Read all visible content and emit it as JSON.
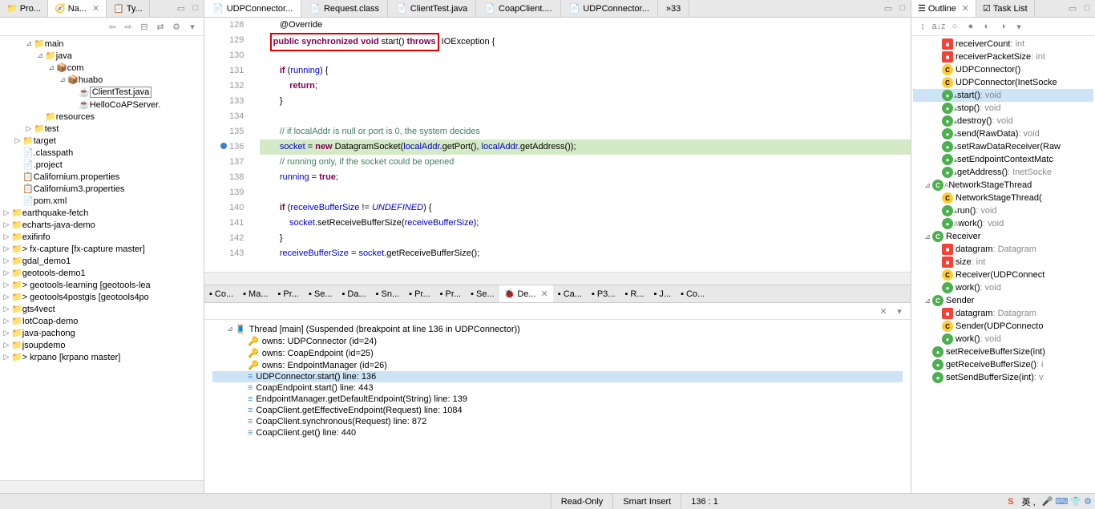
{
  "leftTabs": [
    "Pro...",
    "Na...",
    "Ty..."
  ],
  "projectTree": [
    {
      "indent": 2,
      "tw": "⊿",
      "icon": "folder",
      "label": "main"
    },
    {
      "indent": 3,
      "tw": "⊿",
      "icon": "folder",
      "label": "java"
    },
    {
      "indent": 4,
      "tw": "⊿",
      "icon": "pkg",
      "label": "com"
    },
    {
      "indent": 5,
      "tw": "⊿",
      "icon": "pkg",
      "label": "huabo"
    },
    {
      "indent": 6,
      "tw": "",
      "icon": "java",
      "label": "ClientTest.java",
      "boxed": true
    },
    {
      "indent": 6,
      "tw": "",
      "icon": "java",
      "label": "HelloCoAPServer."
    },
    {
      "indent": 3,
      "tw": "",
      "icon": "folder",
      "label": "resources"
    },
    {
      "indent": 2,
      "tw": "▷",
      "icon": "folder",
      "label": "test"
    },
    {
      "indent": 1,
      "tw": "▷",
      "icon": "folder",
      "label": "target"
    },
    {
      "indent": 1,
      "tw": "",
      "icon": "xml",
      "label": ".classpath"
    },
    {
      "indent": 1,
      "tw": "",
      "icon": "xml",
      "label": ".project"
    },
    {
      "indent": 1,
      "tw": "",
      "icon": "prop",
      "label": "Californium.properties"
    },
    {
      "indent": 1,
      "tw": "",
      "icon": "prop",
      "label": "Californium3.properties"
    },
    {
      "indent": 1,
      "tw": "",
      "icon": "xml",
      "label": "pom.xml"
    },
    {
      "indent": 0,
      "tw": "▷",
      "icon": "proj",
      "label": "earthquake-fetch"
    },
    {
      "indent": 0,
      "tw": "▷",
      "icon": "proj",
      "label": "echarts-java-demo"
    },
    {
      "indent": 0,
      "tw": "▷",
      "icon": "proj",
      "label": "exifinfo"
    },
    {
      "indent": 0,
      "tw": "▷",
      "icon": "proj",
      "label": "> fx-capture [fx-capture master]"
    },
    {
      "indent": 0,
      "tw": "▷",
      "icon": "proj",
      "label": "gdal_demo1"
    },
    {
      "indent": 0,
      "tw": "▷",
      "icon": "proj",
      "label": "geotools-demo1"
    },
    {
      "indent": 0,
      "tw": "▷",
      "icon": "proj",
      "label": "> geotools-learning [geotools-lea"
    },
    {
      "indent": 0,
      "tw": "▷",
      "icon": "proj",
      "label": "> geotools4postgis [geotools4po"
    },
    {
      "indent": 0,
      "tw": "▷",
      "icon": "proj",
      "label": "gts4vect"
    },
    {
      "indent": 0,
      "tw": "▷",
      "icon": "proj",
      "label": "IotCoap-demo"
    },
    {
      "indent": 0,
      "tw": "▷",
      "icon": "proj",
      "label": "java-pachong"
    },
    {
      "indent": 0,
      "tw": "▷",
      "icon": "proj",
      "label": "jsoupdemo"
    },
    {
      "indent": 0,
      "tw": "▷",
      "icon": "proj",
      "label": "> krpano [krpano master]"
    }
  ],
  "editorTabs": [
    {
      "label": "UDPConnector...",
      "icon": "class",
      "active": true
    },
    {
      "label": "Request.class",
      "icon": "class"
    },
    {
      "label": "ClientTest.java",
      "icon": "java"
    },
    {
      "label": "CoapClient....",
      "icon": "class"
    },
    {
      "label": "UDPConnector...",
      "icon": "class"
    }
  ],
  "editorMore": "»33",
  "code": {
    "start": 128,
    "lines": [
      {
        "n": 128,
        "html": "        @Override"
      },
      {
        "n": 129,
        "html": "    <span class='red-box'><span class='kw'>public</span> <span class='kw'>synchronized</span> <span class='kw'>void</span> start() <span class='kw'>throws</span></span> IOException {"
      },
      {
        "n": 130,
        "html": ""
      },
      {
        "n": 131,
        "html": "        <span class='kw'>if</span> (<span class='field'>running</span>) {"
      },
      {
        "n": 132,
        "html": "            <span class='kw'>return</span>;"
      },
      {
        "n": 133,
        "html": "        }"
      },
      {
        "n": 134,
        "html": ""
      },
      {
        "n": 135,
        "html": "        <span class='comment'>// if localAddr is null or port is 0, the system decides</span>"
      },
      {
        "n": 136,
        "html": "        <span class='field'>socket</span> = <span class='kw'>new</span> DatagramSocket(<span class='field'>localAddr</span>.getPort(), <span class='field'>localAddr</span>.getAddress());",
        "bp": true,
        "hl": true
      },
      {
        "n": 137,
        "html": "        <span class='comment'>// running only, if the socket could be opened</span>"
      },
      {
        "n": 138,
        "html": "        <span class='field'>running</span> = <span class='kw'>true</span>;"
      },
      {
        "n": 139,
        "html": ""
      },
      {
        "n": 140,
        "html": "        <span class='kw'>if</span> (<span class='field'>receiveBufferSize</span> != <span class='field italic'>UNDEFINED</span>) {"
      },
      {
        "n": 141,
        "html": "            <span class='field'>socket</span>.setReceiveBufferSize(<span class='field'>receiveBufferSize</span>);"
      },
      {
        "n": 142,
        "html": "        }"
      },
      {
        "n": 143,
        "html": "        <span class='field'>receiveBufferSize</span> = <span class='field'>socket</span>.getReceiveBufferSize();"
      }
    ]
  },
  "bottomTabs": [
    "Co...",
    "Ma...",
    "Pr...",
    "Se...",
    "Da...",
    "Sn...",
    "Pr...",
    "Pr...",
    "Se...",
    "De...",
    "Ca...",
    "P3...",
    "R...",
    "J...",
    "Co..."
  ],
  "bottomActiveIdx": 9,
  "debugTree": [
    {
      "indent": 1,
      "icon": "thread",
      "label": "Thread [main] (Suspended (breakpoint at line 136 in UDPConnector))",
      "tw": "⊿"
    },
    {
      "indent": 2,
      "icon": "owns",
      "label": "owns: UDPConnector  (id=24)"
    },
    {
      "indent": 2,
      "icon": "owns",
      "label": "owns: CoapEndpoint  (id=25)"
    },
    {
      "indent": 2,
      "icon": "owns",
      "label": "owns: EndpointManager  (id=26)"
    },
    {
      "indent": 2,
      "icon": "frame",
      "label": "UDPConnector.start() line: 136",
      "sel": true
    },
    {
      "indent": 2,
      "icon": "frame",
      "label": "CoapEndpoint.start() line: 443"
    },
    {
      "indent": 2,
      "icon": "frame",
      "label": "EndpointManager.getDefaultEndpoint(String) line: 139"
    },
    {
      "indent": 2,
      "icon": "frame",
      "label": "CoapClient.getEffectiveEndpoint(Request) line: 1084"
    },
    {
      "indent": 2,
      "icon": "frame",
      "label": "CoapClient.synchronous(Request) line: 872"
    },
    {
      "indent": 2,
      "icon": "frame",
      "label": "CoapClient.get() line: 440"
    }
  ],
  "rightTabs": [
    "Outline",
    "Task List"
  ],
  "outline": [
    {
      "indent": 1,
      "vis": "priv",
      "label": "receiverCount",
      "type": ": int"
    },
    {
      "indent": 1,
      "vis": "priv",
      "label": "receiverPacketSize",
      "type": ": int"
    },
    {
      "indent": 1,
      "vis": "constructor",
      "label": "UDPConnector()",
      "type": ""
    },
    {
      "indent": 1,
      "vis": "constructor",
      "label": "UDPConnector(InetSocke",
      "type": ""
    },
    {
      "indent": 1,
      "vis": "pub",
      "label": "start()",
      "type": ": void",
      "sel": true,
      "impl": true
    },
    {
      "indent": 1,
      "vis": "pub",
      "label": "stop()",
      "type": ": void",
      "impl": true
    },
    {
      "indent": 1,
      "vis": "pub",
      "label": "destroy()",
      "type": ": void",
      "impl": true
    },
    {
      "indent": 1,
      "vis": "pub",
      "label": "send(RawData)",
      "type": ": void",
      "impl": true
    },
    {
      "indent": 1,
      "vis": "pub",
      "label": "setRawDataReceiver(Raw",
      "type": "",
      "impl": true
    },
    {
      "indent": 1,
      "vis": "pub",
      "label": "setEndpointContextMatc",
      "type": "",
      "impl": true
    },
    {
      "indent": 1,
      "vis": "pub",
      "label": "getAddress()",
      "type": ": InetSocke",
      "impl": true
    },
    {
      "indent": 0,
      "vis": "class",
      "label": "NetworkStageThread",
      "type": "",
      "tw": "⊿",
      "abstract": true
    },
    {
      "indent": 1,
      "vis": "constructor",
      "label": "NetworkStageThread(",
      "type": ""
    },
    {
      "indent": 1,
      "vis": "pub",
      "label": "run()",
      "type": ": void",
      "impl": true
    },
    {
      "indent": 1,
      "vis": "pub",
      "label": "work()",
      "type": ": void",
      "abstract": true
    },
    {
      "indent": 0,
      "vis": "class",
      "label": "Receiver",
      "type": "",
      "tw": "⊿"
    },
    {
      "indent": 1,
      "vis": "priv",
      "label": "datagram",
      "type": ": Datagram"
    },
    {
      "indent": 1,
      "vis": "priv",
      "label": "size",
      "type": ": int"
    },
    {
      "indent": 1,
      "vis": "constructor",
      "label": "Receiver(UDPConnect",
      "type": ""
    },
    {
      "indent": 1,
      "vis": "pub",
      "label": "work()",
      "type": ": void"
    },
    {
      "indent": 0,
      "vis": "class",
      "label": "Sender",
      "type": "",
      "tw": "⊿"
    },
    {
      "indent": 1,
      "vis": "priv",
      "label": "datagram",
      "type": ": Datagram"
    },
    {
      "indent": 1,
      "vis": "constructor",
      "label": "Sender(UDPConnecto",
      "type": ""
    },
    {
      "indent": 1,
      "vis": "pub",
      "label": "work()",
      "type": ": void"
    },
    {
      "indent": 0,
      "vis": "pub",
      "label": "setReceiveBufferSize(int)",
      "type": ""
    },
    {
      "indent": 0,
      "vis": "pub",
      "label": "getReceiveBufferSize()",
      "type": ": i"
    },
    {
      "indent": 0,
      "vis": "pub",
      "label": "setSendBufferSize(int)",
      "type": ": v"
    }
  ],
  "status": {
    "readonly": "Read-Only",
    "insert": "Smart Insert",
    "pos": "136 : 1"
  }
}
